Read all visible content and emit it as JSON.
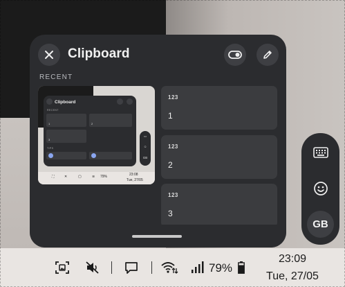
{
  "clipboard": {
    "title": "Clipboard",
    "section_label": "RECENT",
    "items": [
      {
        "type_label": "123",
        "value": "1"
      },
      {
        "type_label": "123",
        "value": "2"
      },
      {
        "type_label": "123",
        "value": "3"
      }
    ],
    "thumbnail": {
      "title": "Clipboard",
      "section_recent": "RECENT",
      "section_tips": "TIPS",
      "cards": [
        "1",
        "2",
        "3"
      ],
      "side_label": "GB",
      "battery": "79%",
      "time": "23:08",
      "date": "Tue, 27/05"
    }
  },
  "input_panel": {
    "layout_label": "GB"
  },
  "taskbar": {
    "battery_percent": "79%",
    "time": "23:09",
    "date": "Tue, 27/05"
  },
  "colors": {
    "panel_bg": "#2b2c2f",
    "card_bg": "#3b3c3f",
    "button_bg": "#3e3f43",
    "taskbar_bg": "#e9e5e2"
  }
}
